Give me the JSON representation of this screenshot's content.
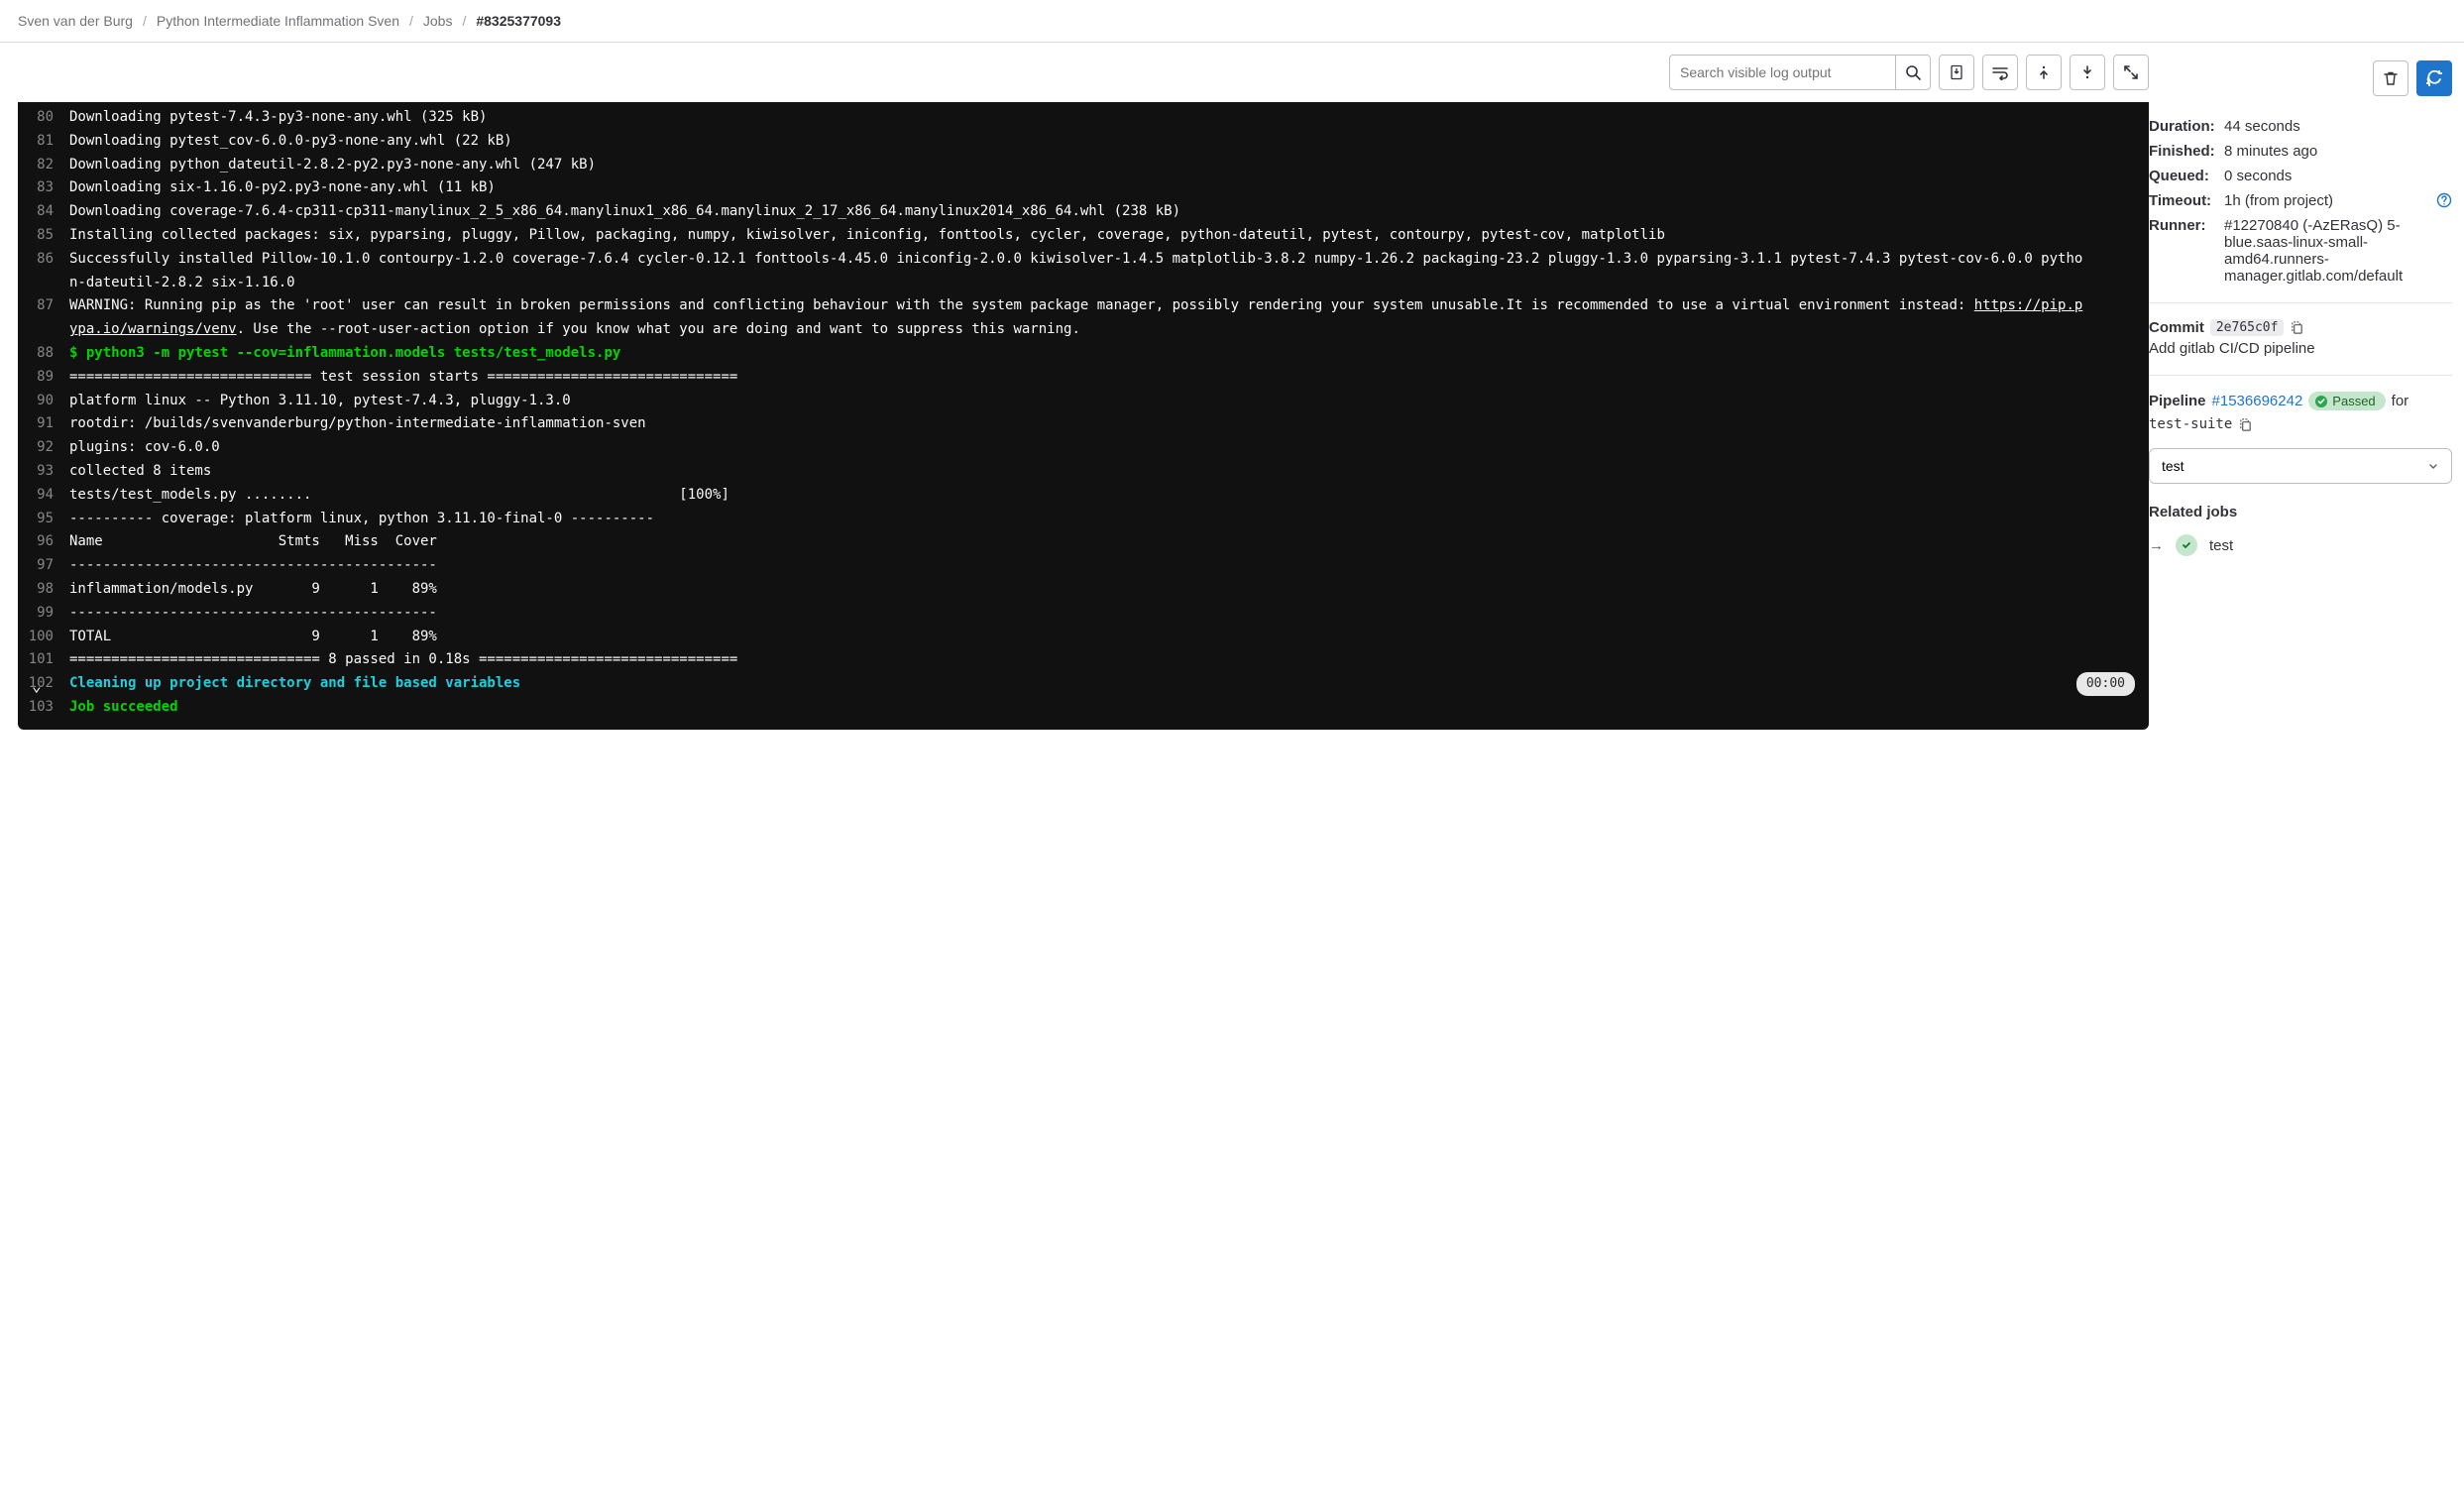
{
  "breadcrumb": {
    "owner": "Sven van der Burg",
    "project": "Python Intermediate Inflammation Sven",
    "jobs": "Jobs",
    "id": "#8325377093"
  },
  "toolbar": {
    "search_placeholder": "Search visible log output"
  },
  "log": {
    "lines": [
      {
        "n": 80,
        "t": "Downloading pytest-7.4.3-py3-none-any.whl (325 kB)"
      },
      {
        "n": 81,
        "t": "Downloading pytest_cov-6.0.0-py3-none-any.whl (22 kB)"
      },
      {
        "n": 82,
        "t": "Downloading python_dateutil-2.8.2-py2.py3-none-any.whl (247 kB)"
      },
      {
        "n": 83,
        "t": "Downloading six-1.16.0-py2.py3-none-any.whl (11 kB)"
      },
      {
        "n": 84,
        "t": "Downloading coverage-7.6.4-cp311-cp311-manylinux_2_5_x86_64.manylinux1_x86_64.manylinux_2_17_x86_64.manylinux2014_x86_64.whl (238 kB)"
      },
      {
        "n": 85,
        "t": "Installing collected packages: six, pyparsing, pluggy, Pillow, packaging, numpy, kiwisolver, iniconfig, fonttools, cycler, coverage, python-dateutil, pytest, contourpy, pytest-cov, matplotlib"
      },
      {
        "n": 86,
        "t": "Successfully installed Pillow-10.1.0 contourpy-1.2.0 coverage-7.6.4 cycler-0.12.1 fonttools-4.45.0 iniconfig-2.0.0 kiwisolver-1.4.5 matplotlib-3.8.2 numpy-1.26.2 packaging-23.2 pluggy-1.3.0 pyparsing-3.1.1 pytest-7.4.3 pytest-cov-6.0.0 python-dateutil-2.8.2 six-1.16.0"
      },
      {
        "n": 87,
        "t": "WARNING: Running pip as the 'root' user can result in broken permissions and conflicting behaviour with the system package manager, possibly rendering your system unusable.It is recommended to use a virtual environment instead: ",
        "link_text": "https://pip.pypa.io/warnings/venv",
        "after": ". Use the --root-user-action option if you know what you are doing and want to suppress this warning."
      },
      {
        "n": 88,
        "c": "green",
        "t": "$ python3 -m pytest --cov=inflammation.models tests/test_models.py"
      },
      {
        "n": 89,
        "t": "============================= test session starts =============================="
      },
      {
        "n": 90,
        "t": "platform linux -- Python 3.11.10, pytest-7.4.3, pluggy-1.3.0"
      },
      {
        "n": 91,
        "t": "rootdir: /builds/svenvanderburg/python-intermediate-inflammation-sven"
      },
      {
        "n": 92,
        "t": "plugins: cov-6.0.0"
      },
      {
        "n": 93,
        "t": "collected 8 items"
      },
      {
        "n": 94,
        "t": "tests/test_models.py ........                                            [100%]"
      },
      {
        "n": 95,
        "t": "---------- coverage: platform linux, python 3.11.10-final-0 ----------"
      },
      {
        "n": 96,
        "t": "Name                     Stmts   Miss  Cover"
      },
      {
        "n": 97,
        "t": "--------------------------------------------"
      },
      {
        "n": 98,
        "t": "inflammation/models.py       9      1    89%"
      },
      {
        "n": 99,
        "t": "--------------------------------------------"
      },
      {
        "n": 100,
        "t": "TOTAL                        9      1    89%"
      },
      {
        "n": 101,
        "t": "============================== 8 passed in 0.18s ==============================="
      },
      {
        "n": 102,
        "c": "cyan",
        "arrow": true,
        "badge": "00:00",
        "t": "Cleaning up project directory and file based variables"
      },
      {
        "n": 103,
        "c": "green",
        "t": "Job succeeded"
      }
    ]
  },
  "meta": {
    "duration_k": "Duration:",
    "duration_v": "44 seconds",
    "finished_k": "Finished:",
    "finished_v": "8 minutes ago",
    "queued_k": "Queued:",
    "queued_v": "0 seconds",
    "timeout_k": "Timeout:",
    "timeout_v": "1h (from project)",
    "runner_k": "Runner:",
    "runner_v": "#12270840 (-AzERasQ) 5-blue.saas-linux-small-amd64.runners-manager.gitlab.com/default"
  },
  "commit": {
    "label": "Commit",
    "sha": "2e765c0f",
    "message": "Add gitlab CI/CD pipeline"
  },
  "pipeline": {
    "label": "Pipeline",
    "id": "#1536696242",
    "status": "Passed",
    "for": "for",
    "branch": "test-suite",
    "select": "test"
  },
  "related": {
    "heading": "Related jobs",
    "job": "test"
  }
}
